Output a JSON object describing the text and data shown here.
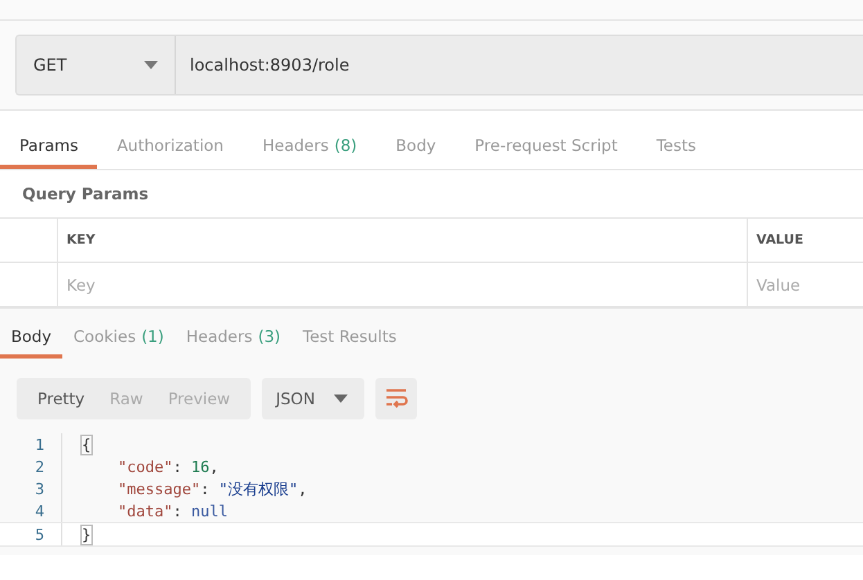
{
  "request": {
    "method": "GET",
    "url": "localhost:8903/role"
  },
  "request_tabs": [
    {
      "label": "Params",
      "selected": true
    },
    {
      "label": "Authorization",
      "selected": false
    },
    {
      "label": "Headers",
      "count": "(8)",
      "selected": false
    },
    {
      "label": "Body",
      "selected": false
    },
    {
      "label": "Pre-request Script",
      "selected": false
    },
    {
      "label": "Tests",
      "selected": false
    }
  ],
  "query_params": {
    "title": "Query Params",
    "columns": [
      "KEY",
      "VALUE"
    ],
    "placeholders": [
      "Key",
      "Value"
    ]
  },
  "response_tabs": [
    {
      "label": "Body",
      "selected": true
    },
    {
      "label": "Cookies",
      "count": "(1)",
      "selected": false
    },
    {
      "label": "Headers",
      "count": "(3)",
      "selected": false
    },
    {
      "label": "Test Results",
      "selected": false
    }
  ],
  "view_modes": [
    {
      "label": "Pretty",
      "selected": true
    },
    {
      "label": "Raw",
      "selected": false
    },
    {
      "label": "Preview",
      "selected": false
    }
  ],
  "format": "JSON",
  "code_lines": [
    {
      "number": "1",
      "current": false,
      "indented": false,
      "tokens": [
        {
          "kind": "bracket_match",
          "text": "{"
        }
      ]
    },
    {
      "number": "2",
      "current": false,
      "indented": true,
      "tokens": [
        {
          "kind": "key",
          "text": "\"code\""
        },
        {
          "kind": "punct",
          "text": ": "
        },
        {
          "kind": "number",
          "text": "16"
        },
        {
          "kind": "punct",
          "text": ","
        }
      ]
    },
    {
      "number": "3",
      "current": false,
      "indented": true,
      "tokens": [
        {
          "kind": "key",
          "text": "\"message\""
        },
        {
          "kind": "punct",
          "text": ": "
        },
        {
          "kind": "string",
          "text": "\"没有权限\""
        },
        {
          "kind": "punct",
          "text": ","
        }
      ]
    },
    {
      "number": "4",
      "current": false,
      "indented": true,
      "tokens": [
        {
          "kind": "key",
          "text": "\"data\""
        },
        {
          "kind": "punct",
          "text": ": "
        },
        {
          "kind": "null",
          "text": "null"
        }
      ]
    },
    {
      "number": "5",
      "current": true,
      "indented": false,
      "tokens": [
        {
          "kind": "bracket_match",
          "text": "}"
        }
      ]
    }
  ]
}
